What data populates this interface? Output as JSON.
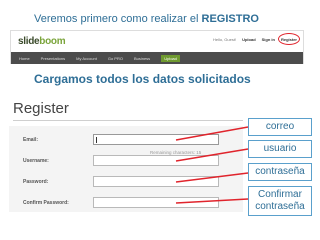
{
  "captions": {
    "top_prefix": "Veremos primero como realizar el ",
    "top_bold": "REGISTRO",
    "middle": "Cargamos todos los datos solicitados"
  },
  "site": {
    "logo_part1": "slide",
    "logo_part2": "boom",
    "userbar": {
      "greeting": "Hello, Guest!",
      "upload": "Upload",
      "sign_in": "Sign in",
      "register": "Register"
    },
    "nav": [
      "Home",
      "Presentations",
      "My Account",
      "Go PRO",
      "Business",
      "Upload"
    ]
  },
  "form": {
    "title": "Register",
    "fields": [
      {
        "label": "Email:",
        "value": ""
      },
      {
        "label": "Username:",
        "value": ""
      },
      {
        "label": "Password:",
        "value": ""
      },
      {
        "label": "Confirm Password:",
        "value": ""
      }
    ],
    "remaining_characters": "Remaining characters: 15"
  },
  "callouts": [
    "correo",
    "usuario",
    "contraseña",
    "Confirmar contraseña"
  ],
  "colors": {
    "caption": "#2e6e96",
    "annotation_red": "#e0242c",
    "callout_border": "#5aa0cc",
    "nav_bar": "#4c4c4c",
    "brand_green": "#7aa43a"
  }
}
